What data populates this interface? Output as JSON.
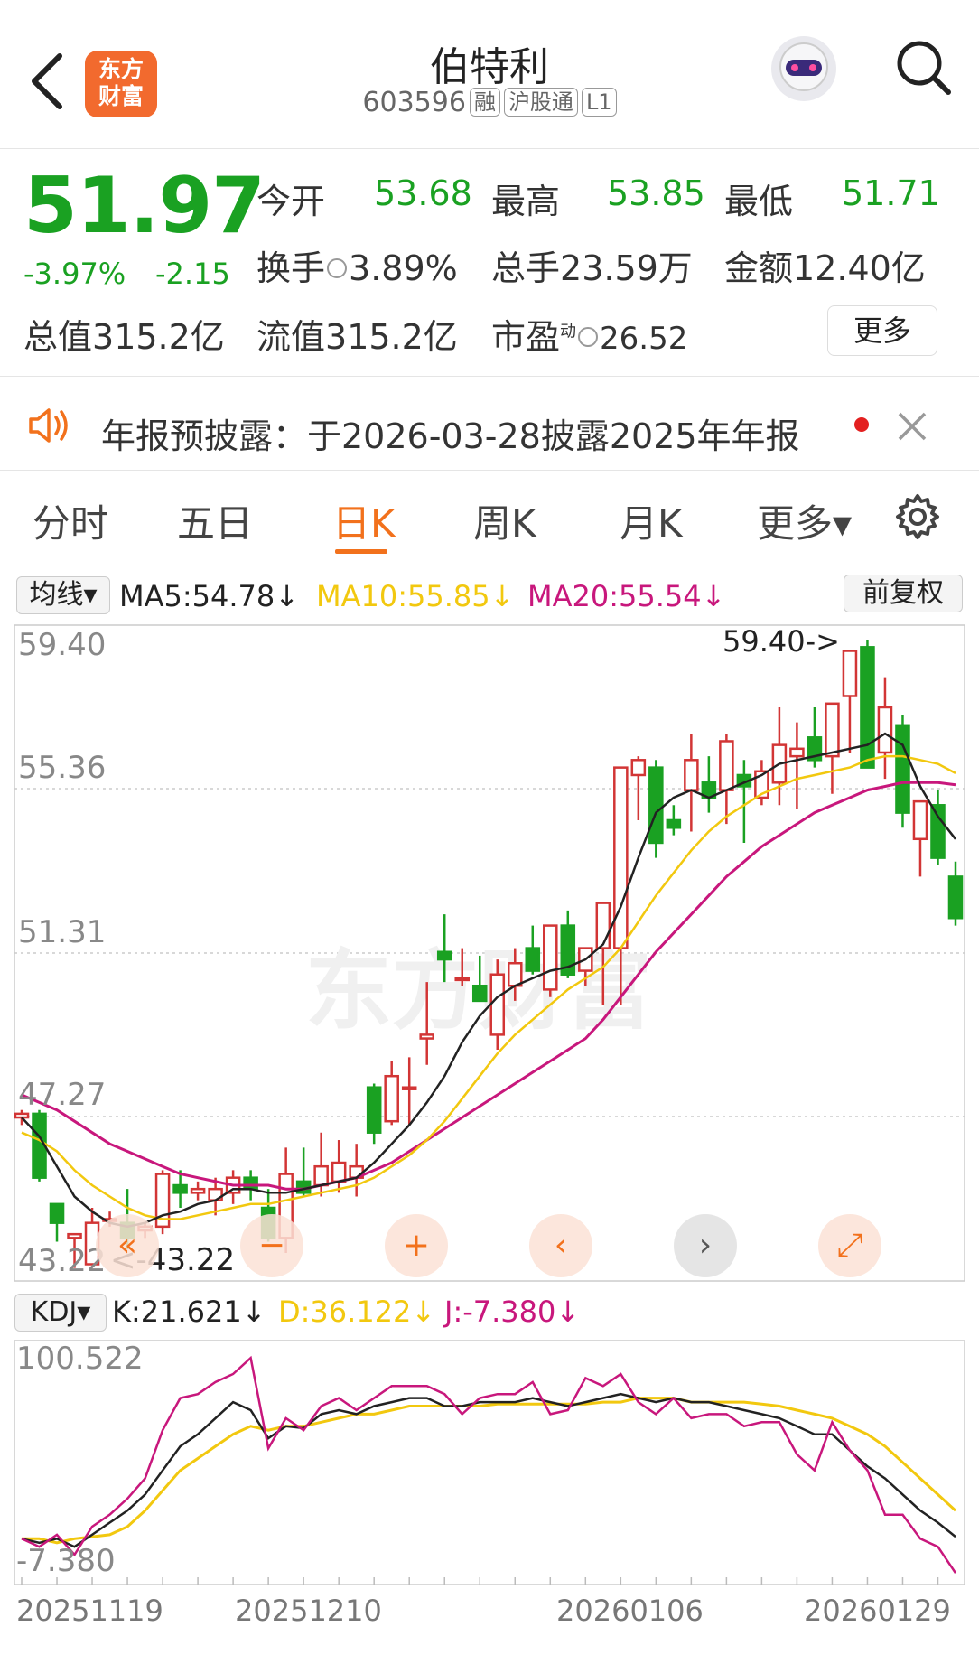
{
  "header": {
    "title": "伯特利",
    "code": "603596",
    "tags": [
      "融",
      "沪股通",
      "L1"
    ],
    "logo_text": [
      "东方",
      "财富"
    ],
    "back_icon": "chevron-left-icon",
    "search_icon": "search-icon",
    "avatar_icon": "robot-avatar-icon"
  },
  "quote": {
    "price": "51.97",
    "pct_change": "-3.97%",
    "change": "-2.15",
    "open_label": "今开",
    "open_value": "53.68",
    "high_label": "最高",
    "high_value": "53.85",
    "low_label": "最低",
    "low_value": "51.71",
    "turnover_label": "换手",
    "turnover_value": "3.89%",
    "volume_label": "总手",
    "volume_value": "23.59万",
    "amount_label": "金额",
    "amount_value": "12.40亿",
    "mktcap_label": "总值",
    "mktcap_value": "315.2亿",
    "float_label": "流值",
    "float_value": "315.2亿",
    "pe_label": "市盈",
    "pe_sup": "动",
    "pe_value": "26.52",
    "more_label": "更多"
  },
  "notice": {
    "text": "年报预披露：于2026-03-28披露2025年年报",
    "icon": "speaker-icon",
    "close_icon": "close-icon"
  },
  "tabs": [
    {
      "label": "分时",
      "active": false
    },
    {
      "label": "五日",
      "active": false
    },
    {
      "label": "日K",
      "active": true
    },
    {
      "label": "周K",
      "active": false
    },
    {
      "label": "月K",
      "active": false
    },
    {
      "label": "更多▾",
      "active": false
    }
  ],
  "settings_icon": "gear-icon",
  "ma_bar": {
    "selector": "均线▾",
    "ma5": "MA5:54.78↓",
    "ma10": "MA10:55.85↓",
    "ma20": "MA20:55.54↓",
    "adjust": "前复权"
  },
  "kdj_bar": {
    "selector": "KDJ▾",
    "k": "K:21.621↓",
    "d": "D:36.122↓",
    "j": "J:-7.380↓"
  },
  "colors": {
    "up": "#d23535",
    "down": "#1aa122",
    "ma5": "#222222",
    "ma10": "#f2c80f",
    "ma20": "#c8177c",
    "accent": "#f2711c"
  },
  "watermark": "东方财富",
  "controls": [
    {
      "icon": "double-chevron-left-icon",
      "glyph": "«"
    },
    {
      "icon": "zoom-out-icon",
      "glyph": "−"
    },
    {
      "icon": "zoom-in-icon",
      "glyph": "+"
    },
    {
      "icon": "chevron-left-icon",
      "glyph": "‹"
    },
    {
      "icon": "chevron-right-icon",
      "glyph": "›"
    },
    {
      "icon": "expand-icon",
      "glyph": "⤢"
    }
  ],
  "chart_data": [
    {
      "type": "candlestick",
      "y_ticks": [
        "59.40",
        "55.36",
        "51.31",
        "47.27",
        "43.22"
      ],
      "ylim": [
        43.22,
        59.4
      ],
      "max_label": "59.40->",
      "min_label": "<-43.22",
      "x_ticks": [
        "20251119",
        "20251210",
        "20260106",
        "20260129"
      ],
      "ohlc": [
        [
          46.7,
          46.9,
          46.5,
          46.8
        ],
        [
          46.8,
          46.9,
          45.0,
          45.1
        ],
        [
          44.4,
          44.4,
          43.4,
          43.9
        ],
        [
          43.5,
          43.5,
          42.7,
          43.6
        ],
        [
          42.8,
          44.3,
          42.8,
          43.9
        ],
        [
          44.0,
          44.2,
          43.8,
          44.0
        ],
        [
          43.9,
          44.8,
          43.2,
          43.5
        ],
        [
          43.7,
          43.9,
          43.5,
          43.8
        ],
        [
          43.8,
          45.3,
          43.6,
          45.2
        ],
        [
          44.9,
          45.3,
          44.3,
          44.7
        ],
        [
          44.7,
          45.0,
          44.5,
          44.8
        ],
        [
          44.5,
          45.1,
          44.1,
          44.8
        ],
        [
          44.7,
          45.3,
          44.4,
          45.1
        ],
        [
          45.1,
          45.3,
          44.5,
          44.8
        ],
        [
          44.3,
          44.8,
          43.4,
          43.5
        ],
        [
          43.5,
          45.9,
          43.1,
          45.2
        ],
        [
          45.0,
          45.9,
          44.6,
          44.7
        ],
        [
          44.9,
          46.3,
          44.6,
          45.4
        ],
        [
          45.0,
          46.1,
          44.7,
          45.5
        ],
        [
          45.1,
          46.0,
          44.6,
          45.4
        ],
        [
          47.5,
          47.6,
          46.0,
          46.3
        ],
        [
          46.6,
          48.2,
          46.5,
          47.8
        ],
        [
          47.5,
          48.3,
          46.5,
          47.5
        ],
        [
          48.8,
          50.3,
          48.1,
          48.9
        ],
        [
          51.1,
          52.1,
          50.3,
          50.9
        ],
        [
          50.4,
          51.2,
          50.2,
          50.4
        ],
        [
          50.2,
          51.0,
          49.9,
          49.8
        ],
        [
          48.9,
          50.9,
          48.5,
          50.5
        ],
        [
          50.2,
          51.2,
          49.8,
          50.8
        ],
        [
          51.2,
          51.8,
          50.5,
          50.6
        ],
        [
          50.1,
          51.5,
          49.9,
          51.8
        ],
        [
          51.8,
          52.2,
          50.4,
          50.5
        ],
        [
          50.6,
          51.2,
          50.2,
          51.2
        ],
        [
          51.2,
          51.4,
          49.7,
          52.4
        ],
        [
          51.2,
          51.4,
          49.7,
          56.0
        ],
        [
          55.8,
          56.3,
          54.6,
          56.2
        ],
        [
          56.0,
          56.2,
          53.6,
          54.0
        ],
        [
          54.6,
          55.0,
          54.2,
          54.4
        ],
        [
          55.4,
          56.9,
          54.3,
          56.2
        ],
        [
          55.6,
          56.3,
          54.8,
          55.2
        ],
        [
          55.4,
          56.9,
          54.5,
          56.7
        ],
        [
          55.8,
          56.2,
          54.0,
          55.5
        ],
        [
          55.2,
          56.2,
          55.0,
          55.9
        ],
        [
          55.6,
          57.6,
          55.0,
          56.6
        ],
        [
          56.3,
          57.2,
          54.9,
          56.5
        ],
        [
          56.8,
          57.6,
          56.0,
          56.2
        ],
        [
          56.3,
          56.6,
          55.3,
          57.7
        ],
        [
          57.9,
          58.9,
          56.4,
          59.1
        ],
        [
          59.2,
          59.4,
          56.2,
          56.0
        ],
        [
          56.4,
          58.4,
          55.7,
          57.6
        ],
        [
          57.1,
          57.4,
          54.4,
          54.8
        ],
        [
          54.1,
          54.8,
          53.1,
          55.1
        ],
        [
          55.0,
          55.4,
          53.4,
          53.6
        ],
        [
          53.1,
          53.5,
          51.8,
          52.0
        ]
      ],
      "ma5": [
        46.7,
        46.2,
        45.4,
        44.6,
        44.2,
        43.9,
        43.8,
        43.9,
        44.1,
        44.2,
        44.4,
        44.5,
        44.8,
        44.8,
        44.7,
        44.7,
        44.8,
        44.9,
        45.0,
        45.1,
        45.5,
        46.0,
        46.5,
        47.1,
        47.8,
        48.7,
        49.4,
        49.9,
        50.2,
        50.4,
        50.6,
        50.7,
        50.9,
        51.3,
        52.3,
        53.6,
        54.8,
        55.2,
        55.4,
        55.2,
        55.4,
        55.6,
        55.8,
        56.1,
        56.2,
        56.3,
        56.4,
        56.5,
        56.6,
        56.9,
        56.6,
        55.5,
        54.7,
        54.1
      ],
      "ma10": [
        46.3,
        46.1,
        45.8,
        45.3,
        44.9,
        44.6,
        44.3,
        44.1,
        44.0,
        44.0,
        44.1,
        44.2,
        44.3,
        44.4,
        44.4,
        44.5,
        44.6,
        44.7,
        44.8,
        44.9,
        45.1,
        45.4,
        45.7,
        46.1,
        46.6,
        47.2,
        47.8,
        48.4,
        48.9,
        49.3,
        49.7,
        50.1,
        50.4,
        50.7,
        51.2,
        51.9,
        52.6,
        53.2,
        53.8,
        54.3,
        54.7,
        55.0,
        55.3,
        55.5,
        55.7,
        55.8,
        55.9,
        56.0,
        56.2,
        56.3,
        56.3,
        56.2,
        56.1,
        55.85
      ],
      "ma20": [
        47.3,
        47.1,
        46.9,
        46.6,
        46.3,
        46.0,
        45.8,
        45.6,
        45.4,
        45.2,
        45.1,
        45.0,
        44.9,
        44.9,
        44.9,
        44.8,
        44.8,
        44.9,
        45.0,
        45.1,
        45.3,
        45.5,
        45.8,
        46.1,
        46.4,
        46.7,
        47.0,
        47.3,
        47.6,
        47.9,
        48.2,
        48.5,
        48.8,
        49.3,
        49.9,
        50.5,
        51.1,
        51.6,
        52.1,
        52.6,
        53.1,
        53.5,
        53.9,
        54.2,
        54.5,
        54.8,
        55.0,
        55.2,
        55.4,
        55.5,
        55.6,
        55.6,
        55.6,
        55.54
      ]
    },
    {
      "type": "line",
      "name_k": "K",
      "name_d": "D",
      "name_j": "J",
      "y_ticks": [
        "100.522",
        "-7.380"
      ],
      "ylim": [
        -7.38,
        100.522
      ],
      "k": [
        10,
        8,
        10,
        6,
        12,
        18,
        24,
        32,
        44,
        56,
        62,
        70,
        78,
        74,
        60,
        66,
        65,
        72,
        74,
        72,
        76,
        78,
        80,
        80,
        76,
        76,
        78,
        78,
        78,
        80,
        78,
        76,
        78,
        80,
        82,
        80,
        78,
        80,
        78,
        78,
        76,
        74,
        72,
        70,
        66,
        62,
        62,
        54,
        46,
        40,
        32,
        24,
        18,
        11
      ],
      "d": [
        10,
        10,
        8,
        10,
        11,
        12,
        16,
        24,
        34,
        44,
        50,
        56,
        62,
        66,
        64,
        66,
        66,
        68,
        70,
        72,
        72,
        74,
        76,
        76,
        76,
        76,
        76,
        77,
        77,
        77,
        77,
        77,
        77,
        78,
        78,
        80,
        80,
        80,
        78,
        78,
        78,
        78,
        77,
        76,
        74,
        72,
        70,
        66,
        62,
        56,
        48,
        40,
        32,
        24
      ],
      "j": [
        10,
        6,
        12,
        2,
        16,
        22,
        30,
        40,
        64,
        80,
        82,
        88,
        92,
        100,
        55,
        70,
        64,
        76,
        80,
        74,
        80,
        86,
        86,
        86,
        82,
        72,
        80,
        82,
        82,
        88,
        72,
        74,
        90,
        86,
        92,
        78,
        72,
        80,
        70,
        72,
        72,
        66,
        68,
        68,
        52,
        44,
        68,
        54,
        44,
        22,
        22,
        10,
        6,
        -7
      ]
    }
  ]
}
